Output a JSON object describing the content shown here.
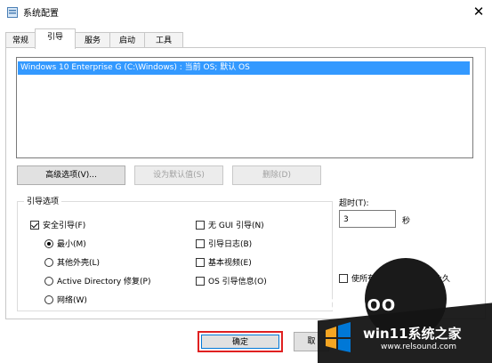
{
  "window": {
    "title": "系统配置",
    "close_glyph": "✕"
  },
  "tabs": [
    {
      "label": "常规"
    },
    {
      "label": "引导"
    },
    {
      "label": "服务"
    },
    {
      "label": "启动"
    },
    {
      "label": "工具"
    }
  ],
  "boot_list": {
    "items": [
      "Windows 10 Enterprise G (C:\\Windows) : 当前 OS; 默认 OS"
    ]
  },
  "buttons": {
    "advanced": "高级选项(V)...",
    "set_default": "设为默认值(S)",
    "delete": "删除(D)",
    "ok": "确定",
    "cancel": "取"
  },
  "boot_options": {
    "group_label": "引导选项",
    "safe_boot": {
      "label": "安全引导(F)",
      "checked": true
    },
    "radios": [
      {
        "label": "最小(M)",
        "selected": true
      },
      {
        "label": "其他外壳(L)",
        "selected": false
      },
      {
        "label": "Active Directory 修复(P)",
        "selected": false
      },
      {
        "label": "网络(W)",
        "selected": false
      }
    ],
    "checks": [
      {
        "label": "无 GUI 引导(N)",
        "checked": false
      },
      {
        "label": "引导日志(B)",
        "checked": false
      },
      {
        "label": "基本视频(E)",
        "checked": false
      },
      {
        "label": "OS 引导信息(O)",
        "checked": false
      }
    ]
  },
  "timeout": {
    "label": "超时(T):",
    "value": "3",
    "unit": "秒"
  },
  "make_permanent": {
    "label": "使所有引",
    "trailing": "永久",
    "checked": false
  },
  "watermark": {
    "brand": "win11系统之家",
    "url": "www.relsound.com",
    "overlay_text": "DOOOO"
  }
}
